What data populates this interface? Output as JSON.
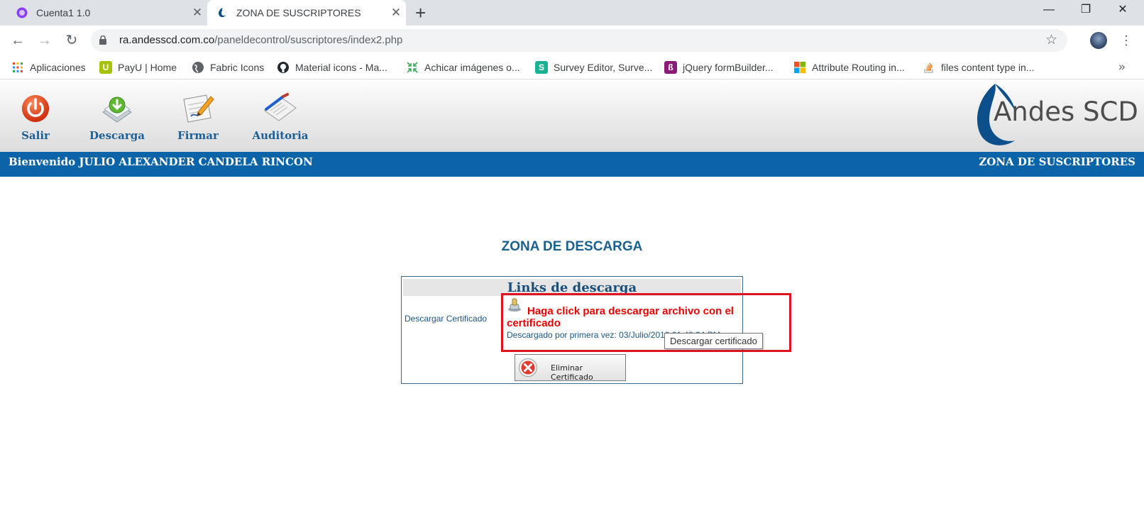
{
  "browser": {
    "tabs": [
      {
        "title": "Cuenta1 1.0",
        "active": false
      },
      {
        "title": "ZONA DE SUSCRIPTORES",
        "active": true
      }
    ],
    "url_host": "ra.andesscd.com.co",
    "url_path": "/paneldecontrol/suscriptores/index2.php",
    "bookmarks": [
      {
        "label": "Aplicaciones",
        "icon": "apps-grid-icon"
      },
      {
        "label": "PayU | Home",
        "icon": "payu-icon"
      },
      {
        "label": "Fabric Icons",
        "icon": "globe-icon"
      },
      {
        "label": "Material icons - Ma...",
        "icon": "github-icon"
      },
      {
        "label": "Achicar imágenes o...",
        "icon": "compress-icon"
      },
      {
        "label": "Survey Editor, Surve...",
        "icon": "surveyjs-icon"
      },
      {
        "label": "jQuery formBuilder...",
        "icon": "formbuilder-icon"
      },
      {
        "label": "Attribute Routing in...",
        "icon": "microsoft-icon"
      },
      {
        "label": "files content type in...",
        "icon": "stackoverflow-icon"
      }
    ]
  },
  "header": {
    "nav": [
      {
        "label": "Salir",
        "icon": "power-icon"
      },
      {
        "label": "Descarga",
        "icon": "download-icon"
      },
      {
        "label": "Firmar",
        "icon": "sign-icon"
      },
      {
        "label": "Auditoria",
        "icon": "audit-icon"
      }
    ],
    "logo_text": "Andes SCD",
    "welcome": "Bienvenido JULIO ALEXANDER CANDELA RINCON",
    "zone": "ZONA DE SUSCRIPTORES"
  },
  "main": {
    "title": "ZONA DE DESCARGA",
    "panel_title": "Links de descarga",
    "row_label": "Descargar Certificado",
    "download_link": "Haga click para descargar archivo con el certificado",
    "downloaded_info": "Descargado por primera vez: 03/Julio/2019 01:48:34 PM",
    "tooltip": "Descargar certificado",
    "delete_button": "Eliminar Certificado"
  },
  "colors": {
    "brand_blue": "#0b63a8",
    "link_red": "#ee0000",
    "highlight_red": "#e0141e"
  }
}
